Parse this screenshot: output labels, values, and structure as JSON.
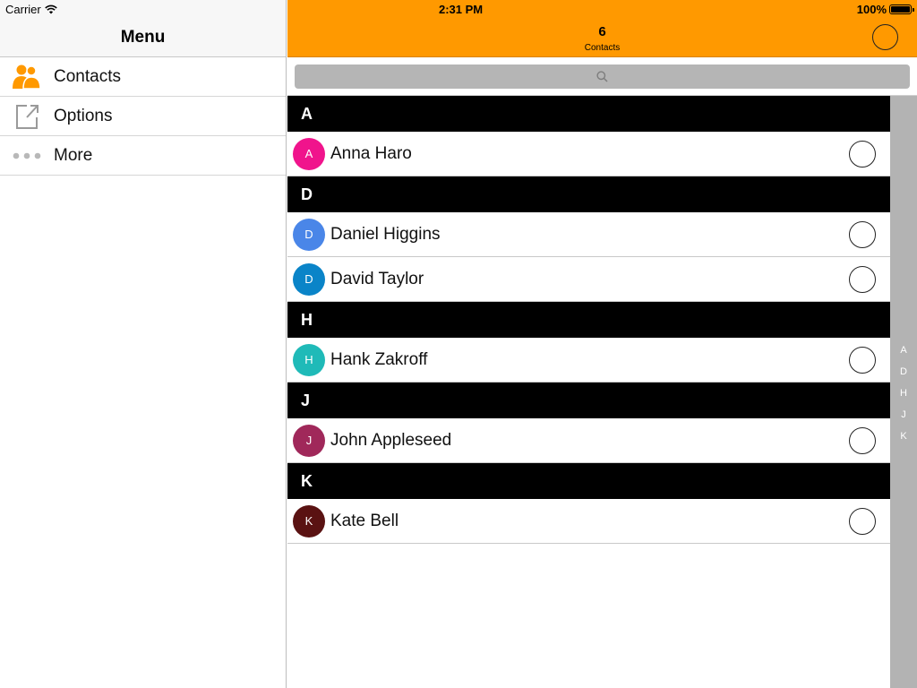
{
  "status_bar": {
    "carrier": "Carrier",
    "time": "2:31 PM",
    "battery": "100%"
  },
  "menu": {
    "title": "Menu",
    "items": [
      {
        "label": "Contacts",
        "icon": "contacts-icon"
      },
      {
        "label": "Options",
        "icon": "external-link-icon"
      },
      {
        "label": "More",
        "icon": "more-dots-icon"
      }
    ]
  },
  "header": {
    "count": "6",
    "subtitle": "Contacts"
  },
  "colors": {
    "accent": "#ff9900",
    "contacts_icon": "#ff9900",
    "index_bar": "#b3b3b3"
  },
  "sections": [
    {
      "letter": "A",
      "contacts": [
        {
          "initial": "A",
          "name": "Anna Haro",
          "color": "#f0148c"
        }
      ]
    },
    {
      "letter": "D",
      "contacts": [
        {
          "initial": "D",
          "name": "Daniel Higgins",
          "color": "#4a86e8"
        },
        {
          "initial": "D",
          "name": "David Taylor",
          "color": "#0a84c8"
        }
      ]
    },
    {
      "letter": "H",
      "contacts": [
        {
          "initial": "H",
          "name": "Hank Zakroff",
          "color": "#1fbab8"
        }
      ]
    },
    {
      "letter": "J",
      "contacts": [
        {
          "initial": "J",
          "name": "John Appleseed",
          "color": "#a0285a"
        }
      ]
    },
    {
      "letter": "K",
      "contacts": [
        {
          "initial": "K",
          "name": "Kate Bell",
          "color": "#5a1212"
        }
      ]
    }
  ],
  "index": [
    "A",
    "D",
    "H",
    "J",
    "K"
  ]
}
